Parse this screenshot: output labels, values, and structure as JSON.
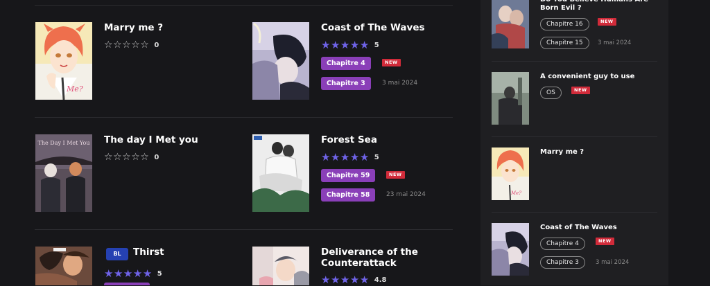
{
  "colors": {
    "page_bg": "#17171a",
    "sidebar_bg": "#1f1f22",
    "star": "#6f63e8",
    "chapter_bg": "#8a3fb8",
    "new_badge": "#d12b3a",
    "bl_badge": "#2541b2"
  },
  "main": {
    "cards": [
      {
        "title": "Marry me ?",
        "rating": "0",
        "stars": 0,
        "chapters": []
      },
      {
        "title": "Coast of The Waves",
        "rating": "5",
        "stars": 5,
        "chapters": [
          {
            "label": "Chapitre 4",
            "new": "NEW"
          },
          {
            "label": "Chapitre 3",
            "date": "3 mai 2024"
          }
        ]
      },
      {
        "title": "The day I Met you",
        "rating": "0",
        "stars": 0,
        "cover_text": "The Day I Met You",
        "chapters": []
      },
      {
        "title": "Forest Sea",
        "rating": "5",
        "stars": 5,
        "chapters": [
          {
            "label": "Chapitre 59",
            "new": "NEW"
          },
          {
            "label": "Chapitre 58",
            "date": "23 mai 2024"
          }
        ]
      },
      {
        "title": "Thirst",
        "badge": "BL",
        "rating": "5",
        "stars": 5,
        "chapters": []
      },
      {
        "title": "Deliverance of the Counterattack",
        "rating": "4.8",
        "stars": 5,
        "chapters": []
      }
    ]
  },
  "sidebar": {
    "items": [
      {
        "title": "Do You Believe Humans Are Born Evil ?",
        "chapters": [
          {
            "label": "Chapitre 16",
            "new": "NEW"
          },
          {
            "label": "Chapitre 15",
            "date": "3 mai 2024"
          }
        ]
      },
      {
        "title": "A convenient guy to use",
        "chapters": [
          {
            "label": "OS",
            "new": "NEW"
          }
        ]
      },
      {
        "title": "Marry me ?",
        "chapters": []
      },
      {
        "title": "Coast of The Waves",
        "chapters": [
          {
            "label": "Chapitre 4",
            "new": "NEW"
          },
          {
            "label": "Chapitre 3",
            "date": "3 mai 2024"
          }
        ]
      }
    ]
  }
}
